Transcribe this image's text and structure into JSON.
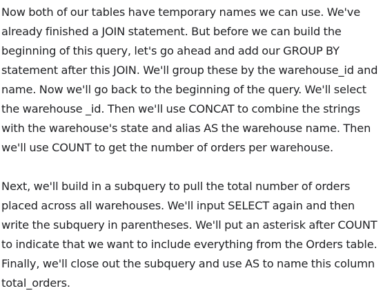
{
  "paragraphs": [
    {
      "lines": [
        "Now both of our tables have temporary names we can use. We've",
        "already finished a JOIN statement. But before we can build the",
        "beginning of this query, let's go ahead and add our GROUP BY",
        "statement after this JOIN. We'll group these by the warehouse_id and",
        "name. Now we'll go back to the beginning of the query. We'll select",
        "the warehouse _id. Then we'll use CONCAT to combine the strings",
        "with the warehouse's state and alias AS the warehouse name. Then",
        "we'll use COUNT to get the number of orders per warehouse."
      ]
    },
    {
      "lines": [
        "Next, we'll build in a subquery to pull the total number of orders",
        "placed across all warehouses. We'll input SELECT again and then",
        "write the subquery in parentheses. We'll put an asterisk after COUNT",
        "to indicate that we want to include everything from the Orders table.",
        "Finally, we'll close out the subquery and use AS to name this column",
        "total_orders."
      ]
    }
  ]
}
